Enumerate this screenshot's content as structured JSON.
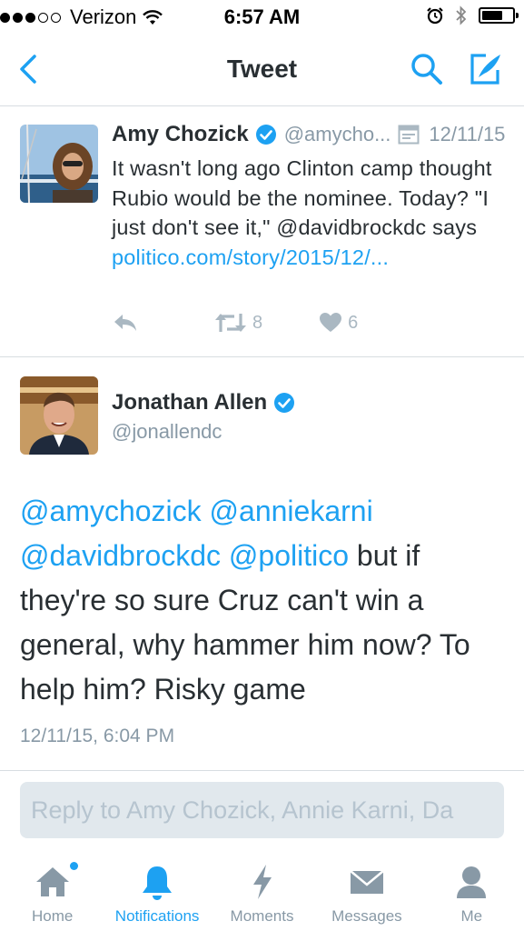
{
  "status_bar": {
    "carrier": "Verizon",
    "time": "6:57 AM",
    "battery_fraction": 0.7
  },
  "nav": {
    "title": "Tweet",
    "back_icon": "back-chevron-icon",
    "search_icon": "search-icon",
    "compose_icon": "compose-icon"
  },
  "quoted_tweet": {
    "name": "Amy Chozick",
    "handle": "@amycho...",
    "date": "12/11/15",
    "text_plain": "It wasn't long ago Clinton camp thought Rubio would be the nominee. Today? \"I just don't see it,\" @davidbrockdc says ",
    "text_link": "politico.com/story/2015/12/...",
    "retweets": "8",
    "likes": "6"
  },
  "main_tweet": {
    "name": "Jonathan Allen",
    "handle": "@jonallendc",
    "mentions": [
      "@amychozick",
      "@anniekarni",
      "@davidbrockdc",
      "@politico"
    ],
    "text": " but if they're so sure Cruz can't win a general, why hammer him now? To help him? Risky game",
    "timestamp": "12/11/15, 6:04 PM"
  },
  "reply": {
    "placeholder": "Reply to Amy Chozick, Annie Karni, Da"
  },
  "tabs": [
    {
      "label": "Home",
      "icon": "home-icon"
    },
    {
      "label": "Notifications",
      "icon": "bell-icon"
    },
    {
      "label": "Moments",
      "icon": "lightning-icon"
    },
    {
      "label": "Messages",
      "icon": "envelope-icon"
    },
    {
      "label": "Me",
      "icon": "person-icon"
    }
  ],
  "colors": {
    "accent": "#1da1f2",
    "text": "#292f33",
    "muted": "#8899a6",
    "verified": "#1da1f2"
  }
}
